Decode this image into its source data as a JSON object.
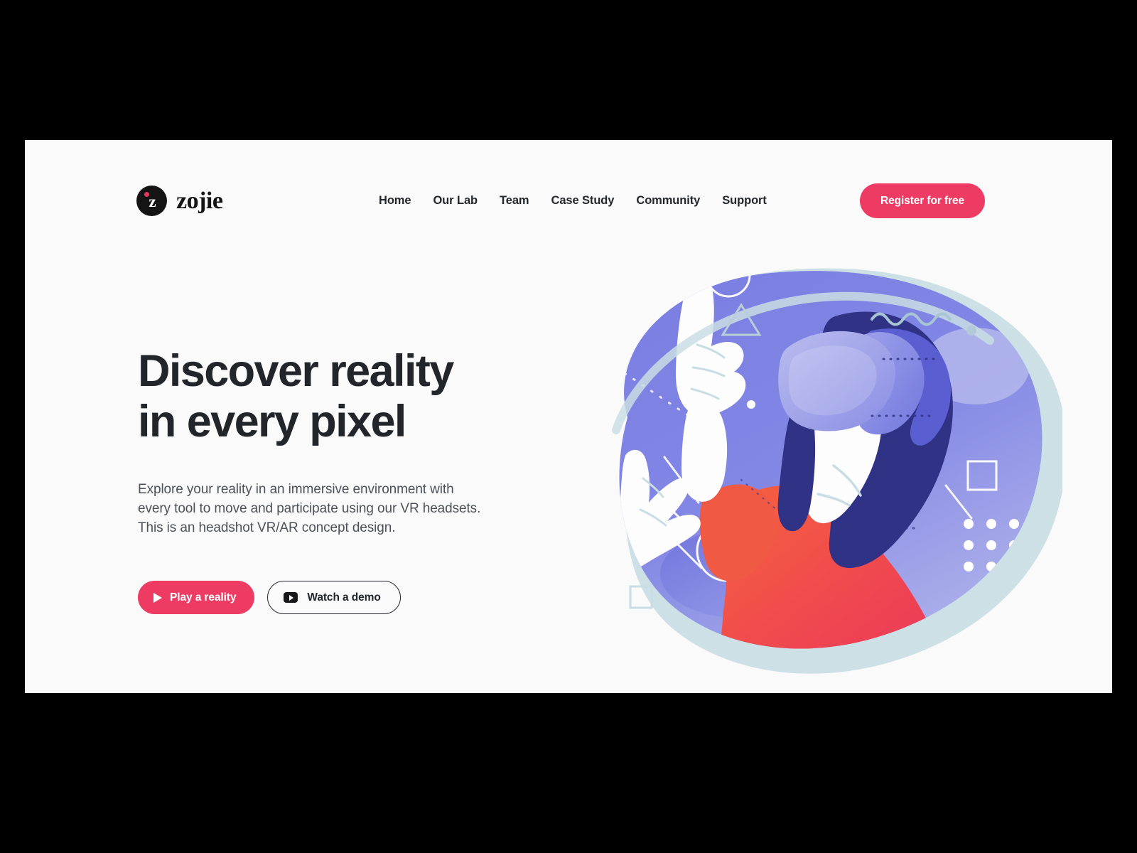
{
  "theme": {
    "page_background": "#000000",
    "card_background": "#fafafa",
    "accent_pink": "#ed3b63",
    "text_dark": "#22252a",
    "text_body": "#4d5159",
    "illus_purple": "#7b7fe0",
    "illus_purple_light": "#9ea2ea",
    "illus_navy": "#2f3285",
    "illus_coral": "#f05a45",
    "illus_red": "#ea3757",
    "illus_mint": "#c4dbe2"
  },
  "header": {
    "brand": {
      "glyph": "z",
      "word": "zojie",
      "mark_icon": "zojie-logo-icon",
      "dot_icon": "logo-accent-dot-icon"
    },
    "nav": [
      {
        "label": "Home"
      },
      {
        "label": "Our Lab"
      },
      {
        "label": "Team"
      },
      {
        "label": "Case Study"
      },
      {
        "label": "Community"
      },
      {
        "label": "Support"
      }
    ],
    "register_label": "Register for free"
  },
  "hero": {
    "headline_line1": "Discover reality",
    "headline_line2": "in every pixel",
    "subcopy": "Explore your reality in an immersive environment with every tool to move and participate using our VR headsets. This is an headshot VR/AR concept design.",
    "primary_cta": {
      "label": "Play a reality",
      "icon": "play-triangle-icon"
    },
    "secondary_cta": {
      "label": "Watch a demo",
      "icon": "youtube-play-icon"
    }
  },
  "illustration": {
    "name": "vr-headset-woman-illustration",
    "description": "Woman wearing a VR headset with raised hands on a purple organic blob background with geometric decorations"
  }
}
